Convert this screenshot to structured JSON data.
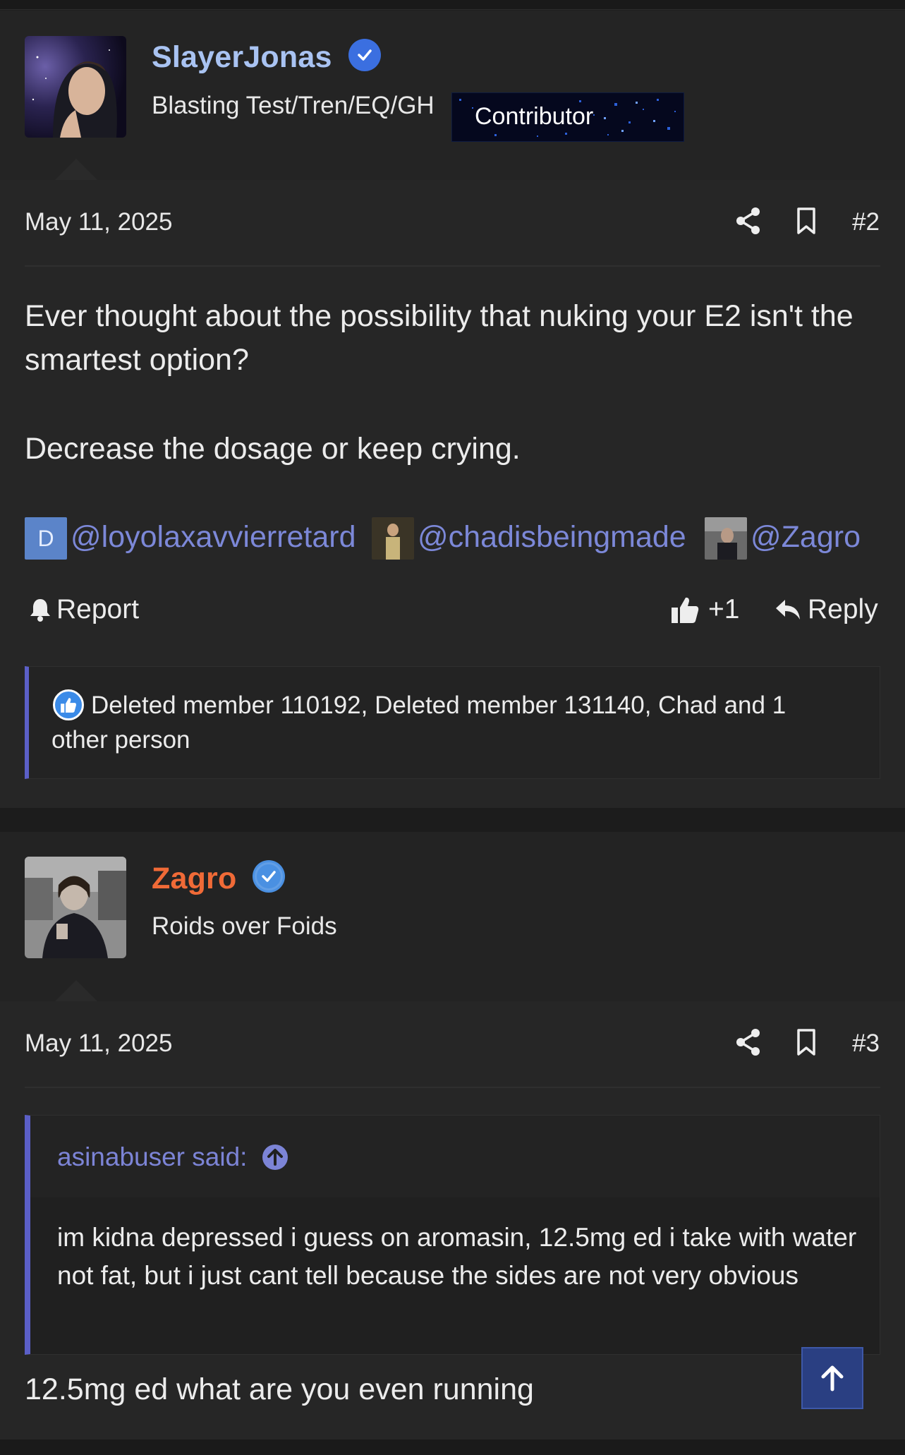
{
  "posts": [
    {
      "author": {
        "username": "SlayerJonas",
        "username_color": "#a9c3f2",
        "verified": true,
        "user_title": "Blasting Test/Tren/EQ/GH",
        "badge": "Contributor"
      },
      "date": "May 11, 2025",
      "post_number": "#2",
      "body": [
        "Ever thought about the possibility that nuking your E2 isn't the smartest option?",
        "Decrease the dosage or keep crying."
      ],
      "mentions": [
        {
          "avatar_letter": "D",
          "text": "@loyolaxavvierretard"
        },
        {
          "avatar_letter": "",
          "text": "@chadisbeingmade"
        },
        {
          "avatar_letter": "",
          "text": "@Zagro"
        }
      ],
      "actions": {
        "report": "Report",
        "like_count": "+1",
        "reply": "Reply"
      },
      "reactions": "Deleted member 110192, Deleted member 131140, Chad and 1 other person"
    },
    {
      "author": {
        "username": "Zagro",
        "username_color": "#f06a37",
        "verified": true,
        "user_title": "Roids over Foids"
      },
      "date": "May 11, 2025",
      "post_number": "#3",
      "quote": {
        "author": "asinabuser said:",
        "text": "im kidna depressed i guess on aromasin, 12.5mg ed i take with water not fat, but i just cant tell because the sides are not very obvious"
      },
      "body": [
        "12.5mg ed what are you even running"
      ]
    }
  ],
  "colors": {
    "accent": "#5b5fc7",
    "mention": "#7c88d8",
    "verified": "#3b6fe0",
    "scroll_top": "#2a3f82"
  },
  "icons": {
    "share": "share-icon",
    "bookmark": "bookmark-icon",
    "report": "bell-icon",
    "like": "thumbs-up-icon",
    "reply": "reply-arrow-icon",
    "quote_jump": "arrow-up-circle-icon",
    "scroll_top": "arrow-up-icon"
  }
}
